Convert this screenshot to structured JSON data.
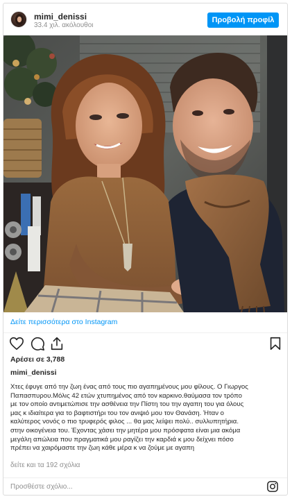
{
  "header": {
    "username": "mimi_denissi",
    "followers": "33.4 χιλ. ακόλουθοι",
    "view_profile_label": "Προβολή προφίλ"
  },
  "post": {
    "more_on_instagram": "Δείτε περισσότερα στο Instagram",
    "likes": "Αρέσει σε 3,788",
    "author": "mimi_denissi",
    "caption": "Χτες έφυγε από την ζωη ένας από τους πιο αγαπημένους μου φίλους. Ο Γιωργος\nΠαπασπυρου.Μόλις 42 ετών χτυπημένος από τον καρκινο.θαύμασα τον τρόπο\nμε τον οποίο αντιμετώπισε την ασθένεια την Πίστη του την αγαπη του για όλους\nμας κ ιδιαίτερα για το βαφτιστήρι του τον ανιψιό μου τον Θανάση. Ήταν ο\nκαλύτερος νονός ο πιο τρυφερός φιλος ... θα μας λείψει πολύ.. συλλυπητήρια.\nστην οικογένεια του. Έχοντας χάσει την μητέρα μου πρόσφατα είναι μια ακόμα\nμεγάλη απώλεια που πραγματικά μου ραγίζει την καρδιά κ μου δείχνει πόσο\nπρέπει να χαιρόμαστε την ζωη κάθε μέρα κ να ζούμε με αγαπη",
    "comments_link": "δείτε και τα 192 σχόλια"
  },
  "comment_box": {
    "placeholder": "Προσθέστε σχόλιο..."
  },
  "icons": {
    "like": "heart-icon",
    "comment": "comment-icon",
    "share": "share-icon",
    "save": "bookmark-icon",
    "instagram": "instagram-icon"
  },
  "colors": {
    "accent": "#0095f6",
    "muted_text": "#8e8e8e"
  }
}
